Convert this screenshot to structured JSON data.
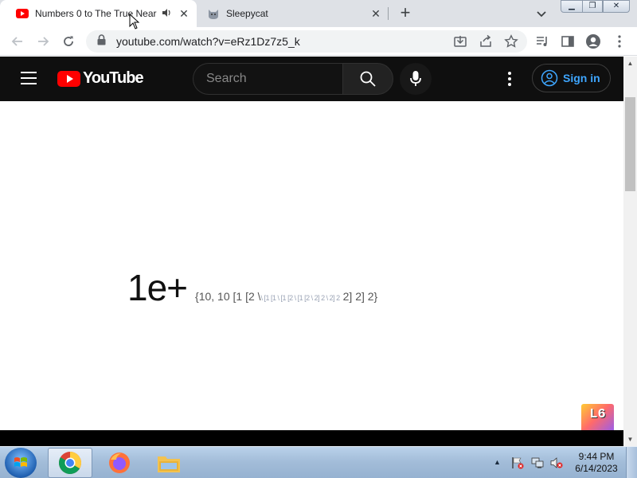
{
  "browser": {
    "tabs": [
      {
        "title": "Numbers 0 to The True Near",
        "favicon": "youtube-icon",
        "active": true,
        "audio": "speaker-icon"
      },
      {
        "title": "Sleepycat",
        "favicon": "cat-icon",
        "active": false
      }
    ],
    "new_tab_label": "+",
    "url": "youtube.com/watch?v=eRz1Dz7z5_k"
  },
  "youtube": {
    "logo_text": "YouTube",
    "search_placeholder": "Search",
    "signin_label": "Sign in"
  },
  "video": {
    "main_text": "1e+",
    "sub_text": "{10, 10 [1 [2 \\",
    "faint_text": "\\ [1 [1 \\ [1 [2 \\ [1 [2 \\ 2] 2 \\ 2] 2",
    "sub_text_end": "2] 2] 2}",
    "badge": "L6"
  },
  "taskbar": {
    "apps": [
      "chrome-icon",
      "firefox-icon",
      "file-explorer-icon"
    ],
    "time": "9:44 PM",
    "date": "6/14/2023"
  },
  "colors": {
    "youtube_red": "#ff0000",
    "signin_blue": "#3ea6ff",
    "header_bg": "#0f0f0f"
  }
}
